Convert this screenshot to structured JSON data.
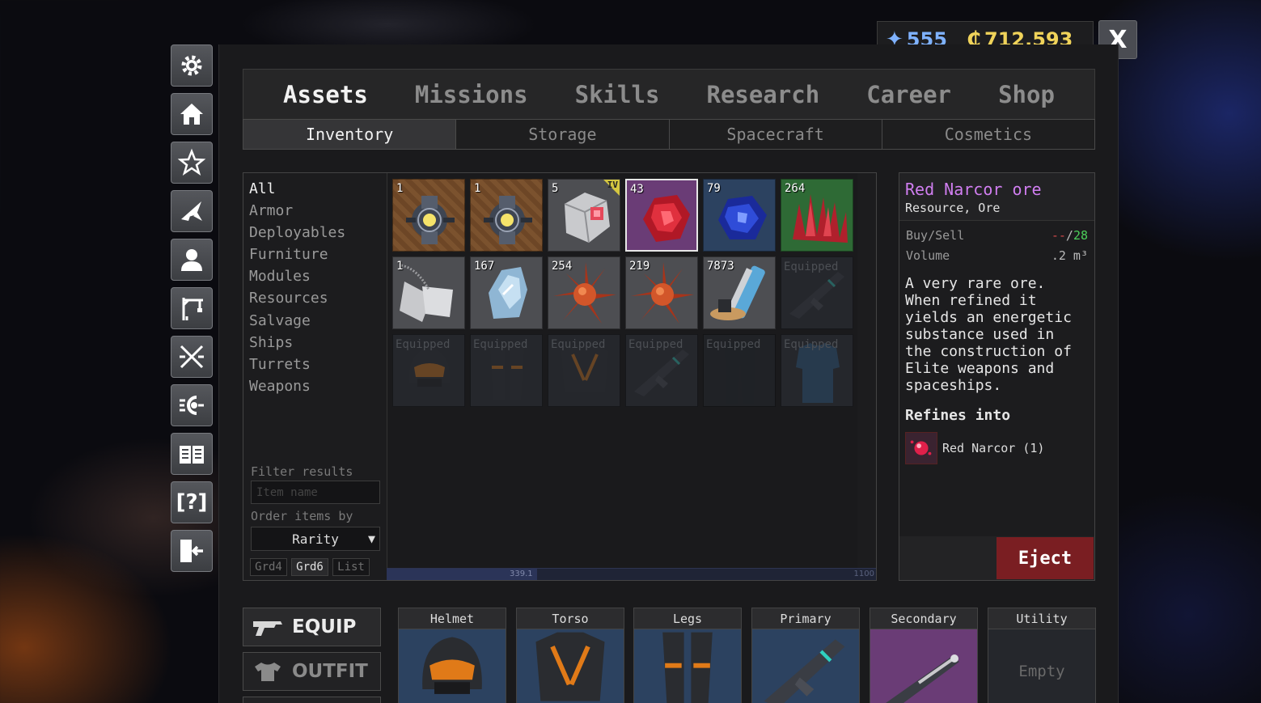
{
  "currency": {
    "gems": "555",
    "credits": "712,593"
  },
  "close_label": "X",
  "side_icons": [
    "gear-icon",
    "home-icon",
    "star-icon",
    "ship-icon",
    "profile-icon",
    "crane-icon",
    "crossed-swords-icon",
    "radar-icon",
    "book-icon",
    "help-icon",
    "exit-icon"
  ],
  "help_glyph": "[?]",
  "tabs": [
    "Assets",
    "Missions",
    "Skills",
    "Research",
    "Career",
    "Shop"
  ],
  "active_tab": "Assets",
  "subtabs": [
    "Inventory",
    "Storage",
    "Spacecraft",
    "Cosmetics"
  ],
  "active_subtab": "Inventory",
  "categories": [
    "All",
    "Armor",
    "Deployables",
    "Furniture",
    "Modules",
    "Resources",
    "Salvage",
    "Ships",
    "Turrets",
    "Weapons"
  ],
  "active_category": "All",
  "filter": {
    "label": "Filter results",
    "placeholder": "Item name",
    "order_label": "Order items by",
    "order_value": "Rarity"
  },
  "view_modes": [
    "Grd4",
    "Grd6",
    "List"
  ],
  "active_view": "Grd6",
  "equipped_label": "Equipped",
  "items": [
    {
      "count": "1",
      "bg": "wood",
      "art": "module"
    },
    {
      "count": "1",
      "bg": "wood",
      "art": "module"
    },
    {
      "count": "5",
      "bg": "gray",
      "art": "hex-device",
      "tier": "IV"
    },
    {
      "count": "43",
      "bg": "purple",
      "art": "red-ore",
      "selected": true
    },
    {
      "count": "79",
      "bg": "blue",
      "art": "blue-ore"
    },
    {
      "count": "264",
      "bg": "green",
      "art": "red-crystal"
    },
    {
      "count": "1",
      "bg": "gray",
      "art": "dog-tags"
    },
    {
      "count": "167",
      "bg": "gray",
      "art": "ice-rock"
    },
    {
      "count": "254",
      "bg": "gray",
      "art": "orange-crystal"
    },
    {
      "count": "219",
      "bg": "gray",
      "art": "orange-crystal"
    },
    {
      "count": "7873",
      "bg": "gray",
      "art": "tool"
    },
    {
      "equipped": true,
      "bg": "dark",
      "art": "rifle"
    },
    {
      "equipped": true,
      "bg": "dark",
      "art": "helmet"
    },
    {
      "equipped": true,
      "bg": "dark",
      "art": "legs"
    },
    {
      "equipped": true,
      "bg": "dark",
      "art": "torso"
    },
    {
      "equipped": true,
      "bg": "dark",
      "art": "rifle"
    },
    {
      "equipped": true,
      "bg": "dark2",
      "art": "pants"
    },
    {
      "equipped": true,
      "bg": "dark",
      "art": "shirt"
    }
  ],
  "scroll": {
    "value": "339.1",
    "max": "1100"
  },
  "detail": {
    "name": "Red Narcor ore",
    "type": "Resource, Ore",
    "buy_sell_label": "Buy/Sell",
    "buy": "--",
    "slash": "/",
    "sell": "28",
    "volume_label": "Volume",
    "volume": ".2 m³",
    "description": "A very rare ore.\nWhen refined it\nyields an energetic\nsubstance used in\nthe construction of\nElite weapons and\nspaceships.",
    "refines_title": "Refines into",
    "refines_item": "Red Narcor (1)",
    "eject_label": "Eject"
  },
  "bottom_buttons": {
    "equip": "EQUIP",
    "outfit": "OUTFIT"
  },
  "equip_slots": [
    {
      "label": "Helmet",
      "art": "helmet",
      "bg": "blue"
    },
    {
      "label": "Torso",
      "art": "torso",
      "bg": "blue"
    },
    {
      "label": "Legs",
      "art": "legs",
      "bg": "blue"
    },
    {
      "label": "Primary",
      "art": "rifle",
      "bg": "blue"
    },
    {
      "label": "Secondary",
      "art": "pistol",
      "bg": "purple"
    },
    {
      "label": "Utility",
      "empty": "Empty",
      "bg": "dark"
    }
  ],
  "colors": {
    "rarity_elite": "#d07ef0",
    "eject": "#7a1e22",
    "gems": "#7fb2ff",
    "credits": "#f0d35a"
  }
}
